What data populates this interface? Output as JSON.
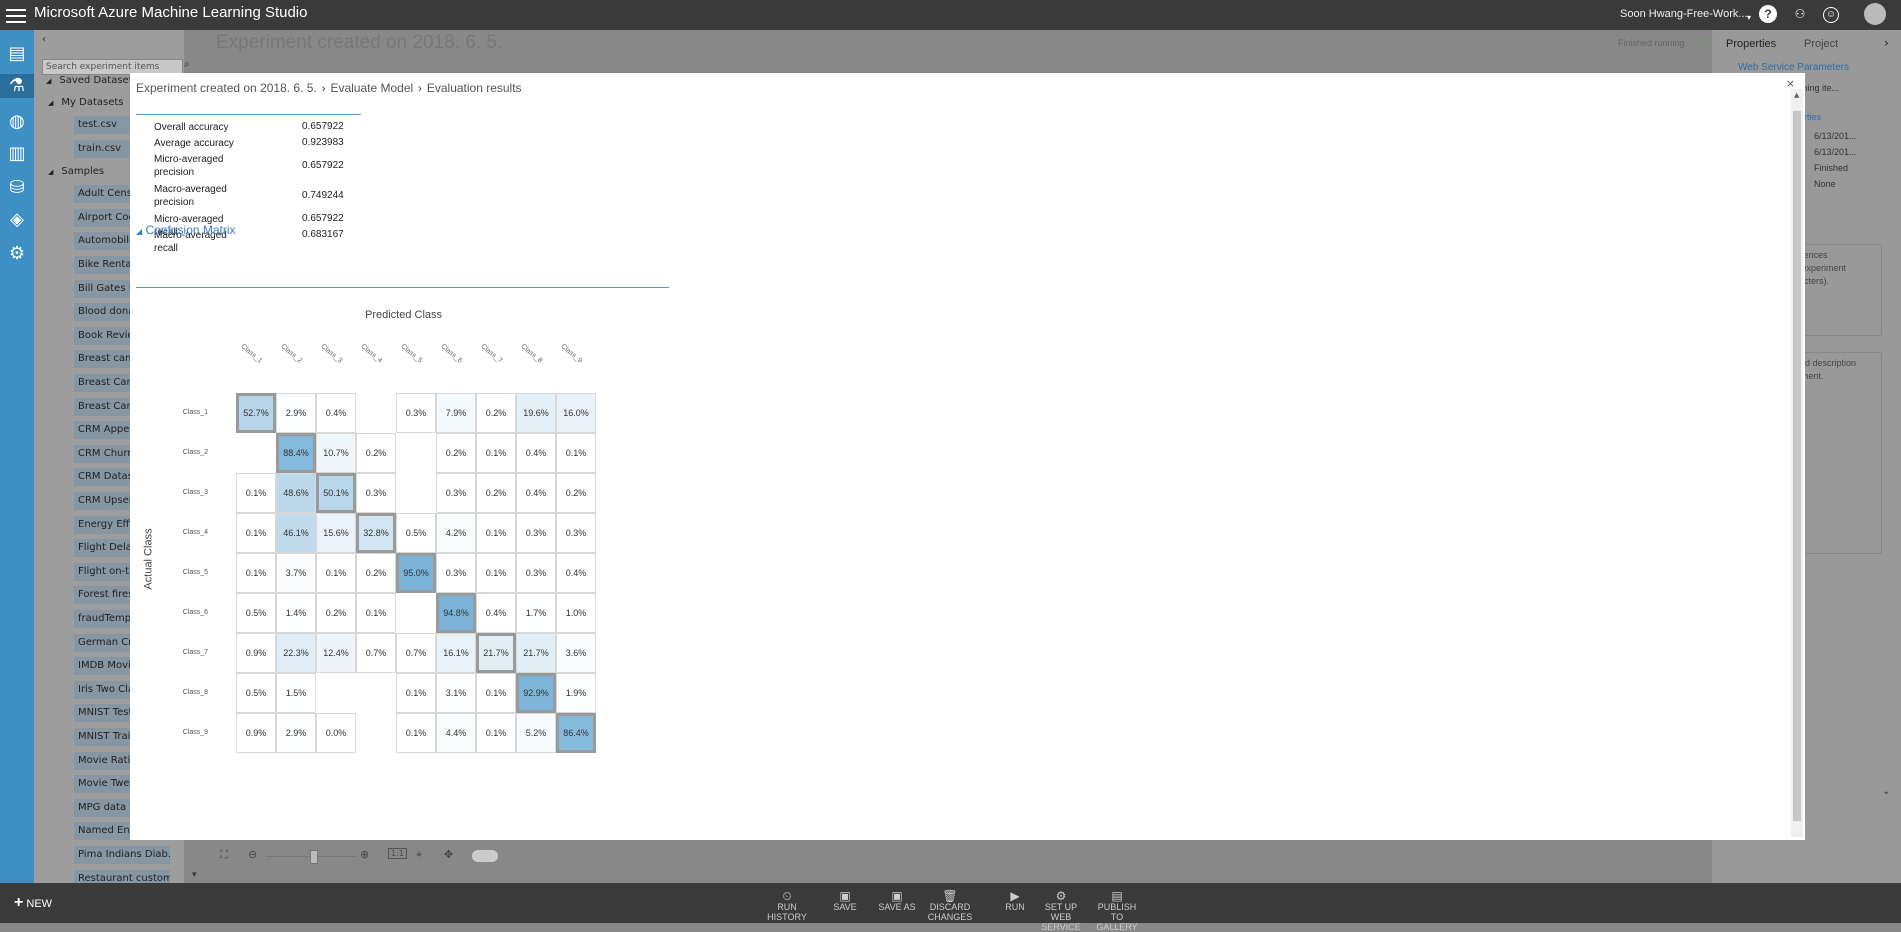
{
  "app": {
    "title": "Microsoft Azure Machine Learning Studio",
    "user": "Soon Hwang-Free-Work..."
  },
  "background": {
    "experiment_title": "Experiment created on 2018. 6. 5.",
    "search_placeholder": "Search experiment items",
    "status": "Finished running",
    "tree": [
      {
        "label": "Saved Datasets",
        "indent": 1
      },
      {
        "label": "My Datasets",
        "indent": 2
      },
      {
        "label": "test.csv",
        "indent": 3
      },
      {
        "label": "train.csv",
        "indent": 3
      },
      {
        "label": "Samples",
        "indent": 2
      },
      {
        "label": "Adult Census",
        "indent": 3
      },
      {
        "label": "Airport Codes",
        "indent": 3
      },
      {
        "label": "Automobile",
        "indent": 3
      },
      {
        "label": "Bike Rental",
        "indent": 3
      },
      {
        "label": "Bill Gates RG",
        "indent": 3
      },
      {
        "label": "Blood donat",
        "indent": 3
      },
      {
        "label": "Book Review",
        "indent": 3
      },
      {
        "label": "Breast cance",
        "indent": 3
      },
      {
        "label": "Breast Cance",
        "indent": 3
      },
      {
        "label": "Breast Cance",
        "indent": 3
      },
      {
        "label": "CRM Appete",
        "indent": 3
      },
      {
        "label": "CRM Churn",
        "indent": 3
      },
      {
        "label": "CRM Datase",
        "indent": 3
      },
      {
        "label": "CRM Upsell",
        "indent": 3
      },
      {
        "label": "Energy Effici",
        "indent": 3
      },
      {
        "label": "Flight Delay",
        "indent": 3
      },
      {
        "label": "Flight on-tin",
        "indent": 3
      },
      {
        "label": "Forest fires",
        "indent": 3
      },
      {
        "label": "fraudTempl",
        "indent": 3
      },
      {
        "label": "German Cre",
        "indent": 3
      },
      {
        "label": "IMDB Movie",
        "indent": 3
      },
      {
        "label": "Iris Two Clas",
        "indent": 3
      },
      {
        "label": "MNIST Test",
        "indent": 3
      },
      {
        "label": "MNIST Train",
        "indent": 3
      },
      {
        "label": "Movie Ratin",
        "indent": 3
      },
      {
        "label": "Movie Twee",
        "indent": 3
      },
      {
        "label": "MPG data fo",
        "indent": 3
      },
      {
        "label": "Named Enti",
        "indent": 3
      },
      {
        "label": "Pima Indians Diab...",
        "indent": 3
      },
      {
        "label": "Restaurant custom...",
        "indent": 3
      }
    ],
    "right_panel": {
      "tabs": [
        "Properties",
        "Project"
      ],
      "link": "Web Service Parameters",
      "subheading": "roperties",
      "running_item": "Running ite...",
      "values": [
        "6/13/201...",
        "6/13/201...",
        "Finished",
        "None"
      ],
      "summary_text": [
        "entences",
        "ur experiment",
        "aracters)."
      ],
      "description_text": [
        "ailed description",
        "eriment."
      ]
    },
    "bottom_actions": [
      {
        "icon": "history-icon",
        "label": "RUN HISTORY"
      },
      {
        "icon": "save-icon",
        "label": "SAVE"
      },
      {
        "icon": "save-as-icon",
        "label": "SAVE AS"
      },
      {
        "icon": "trash-icon",
        "label": "DISCARD CHANGES"
      },
      {
        "icon": "play-icon",
        "label": "RUN"
      },
      {
        "icon": "web-service-icon",
        "label": "SET UP WEB SERVICE"
      },
      {
        "icon": "gallery-icon",
        "label": "PUBLISH TO GALLERY"
      }
    ],
    "new_button": "NEW"
  },
  "dialog": {
    "breadcrumb": [
      "Experiment created on 2018. 6. 5.",
      "Evaluate Model",
      "Evaluation results"
    ],
    "close": "×",
    "metrics": [
      {
        "label": "Overall accuracy",
        "value": "0.657922"
      },
      {
        "label": "Average accuracy",
        "value": "0.923983"
      },
      {
        "label": "Micro-averaged precision",
        "value": "0.657922"
      },
      {
        "label": "Macro-averaged precision",
        "value": "0.749244"
      },
      {
        "label": "Micro-averaged recall",
        "value": "0.657922"
      },
      {
        "label": "Macro-averaged recall",
        "value": "0.683167"
      }
    ],
    "section_title": "Confusion Matrix",
    "predicted_label": "Predicted Class",
    "actual_label": "Actual Class",
    "column_labels": [
      "Class_1",
      "Class_2",
      "Class_3",
      "Class_4",
      "Class_5",
      "Class_6",
      "Class_7",
      "Class_8",
      "Class_9"
    ],
    "row_labels": [
      "Class_1",
      "Class_2",
      "Class_3",
      "Class_4",
      "Class_5",
      "Class_6",
      "Class_7",
      "Class_8",
      "Class_9"
    ],
    "matrix": [
      [
        "52.7%",
        "2.9%",
        "0.4%",
        "",
        "0.3%",
        "7.9%",
        "0.2%",
        "19.6%",
        "16.0%"
      ],
      [
        "",
        "88.4%",
        "10.7%",
        "0.2%",
        "",
        "0.2%",
        "0.1%",
        "0.4%",
        "0.1%"
      ],
      [
        "0.1%",
        "48.6%",
        "50.1%",
        "0.3%",
        "",
        "0.3%",
        "0.2%",
        "0.4%",
        "0.2%"
      ],
      [
        "0.1%",
        "46.1%",
        "15.6%",
        "32.8%",
        "0.5%",
        "4.2%",
        "0.1%",
        "0.3%",
        "0.3%"
      ],
      [
        "0.1%",
        "3.7%",
        "0.1%",
        "0.2%",
        "95.0%",
        "0.3%",
        "0.1%",
        "0.3%",
        "0.4%"
      ],
      [
        "0.5%",
        "1.4%",
        "0.2%",
        "0.1%",
        "",
        "94.8%",
        "0.4%",
        "1.7%",
        "1.0%"
      ],
      [
        "0.9%",
        "22.3%",
        "12.4%",
        "0.7%",
        "0.7%",
        "16.1%",
        "21.7%",
        "21.7%",
        "3.6%"
      ],
      [
        "0.5%",
        "1.5%",
        "",
        "",
        "0.1%",
        "3.1%",
        "0.1%",
        "92.9%",
        "1.9%"
      ],
      [
        "0.9%",
        "2.9%",
        "0.0%",
        "",
        "0.1%",
        "4.4%",
        "0.1%",
        "5.2%",
        "86.4%"
      ]
    ]
  }
}
